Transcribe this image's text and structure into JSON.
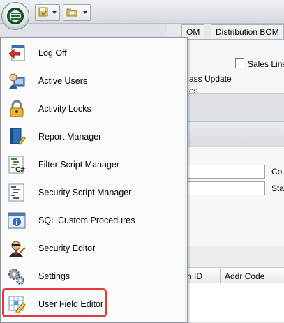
{
  "background": {
    "tabs": [
      "OM",
      "Distribution BOM"
    ],
    "sales_line_label": "Sales Line I",
    "mass_update_label": "ass Update",
    "section_label": "es",
    "field_labels": [
      "Co",
      "Sta"
    ],
    "grid_headers": [
      "n ID",
      "Addr Code"
    ]
  },
  "menu": {
    "items": [
      {
        "label": "Log Off",
        "icon": "log-off-icon"
      },
      {
        "label": "Active Users",
        "icon": "active-users-icon"
      },
      {
        "label": "Activity Locks",
        "icon": "padlock-icon"
      },
      {
        "label": "Report Manager",
        "icon": "report-book-icon"
      },
      {
        "label": "Filter Script Manager",
        "icon": "csharp-script-icon"
      },
      {
        "label": "Security Script Manager",
        "icon": "security-script-icon"
      },
      {
        "label": "SQL Custom Procedures",
        "icon": "info-window-icon"
      },
      {
        "label": "Security Editor",
        "icon": "security-agent-icon"
      },
      {
        "label": "Settings",
        "icon": "gears-icon"
      },
      {
        "label": "User Field Editor",
        "icon": "grid-pencil-icon"
      }
    ],
    "highlighted": "User Field Editor",
    "highlight_color": "#e23b3b"
  }
}
